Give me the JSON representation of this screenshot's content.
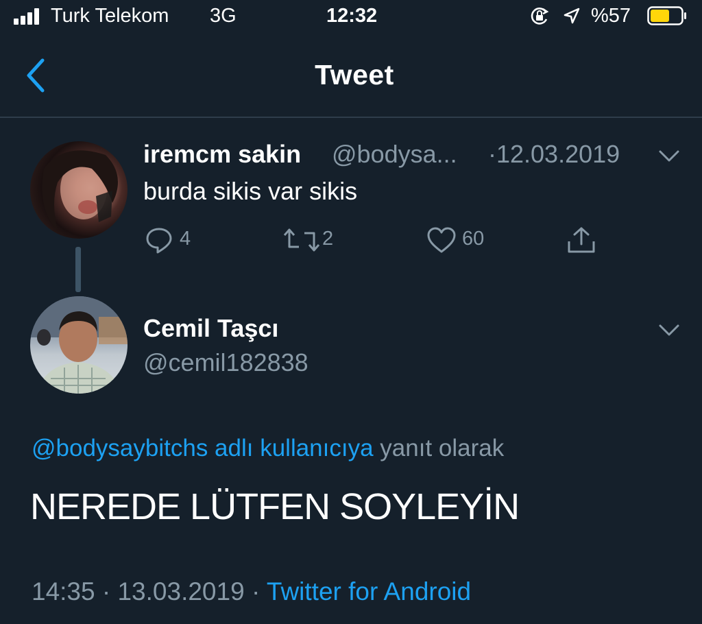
{
  "status_bar": {
    "carrier": "Turk Telekom",
    "network": "3G",
    "time": "12:32",
    "battery_percent": "%57",
    "icons": [
      "signal-bars-icon",
      "rotation-lock-icon",
      "location-arrow-icon",
      "battery-icon"
    ]
  },
  "nav": {
    "title": "Tweet",
    "back_icon": "chevron-left-icon"
  },
  "parent_tweet": {
    "display_name": "iremcm sakin",
    "handle": "@bodysa...",
    "date": "·12.03.2019",
    "text": "burda sikis var sikis",
    "replies": "4",
    "retweets": "2",
    "likes": "60"
  },
  "main_tweet": {
    "display_name": "Cemil Taşcı",
    "handle": "@cemil182838",
    "reply_to_user": "@bodysaybitchs adlı kullanıcıya",
    "reply_to_suffix": "yanıt olarak",
    "text": "NEREDE LÜTFEN SOYLEYİN",
    "time": "14:35",
    "date": "13.03.2019",
    "source": "Twitter for Android",
    "separator": "·"
  },
  "colors": {
    "background": "#15202b",
    "accent": "#1da1f2",
    "secondary_text": "#8899a6",
    "battery": "#ffd60a"
  }
}
